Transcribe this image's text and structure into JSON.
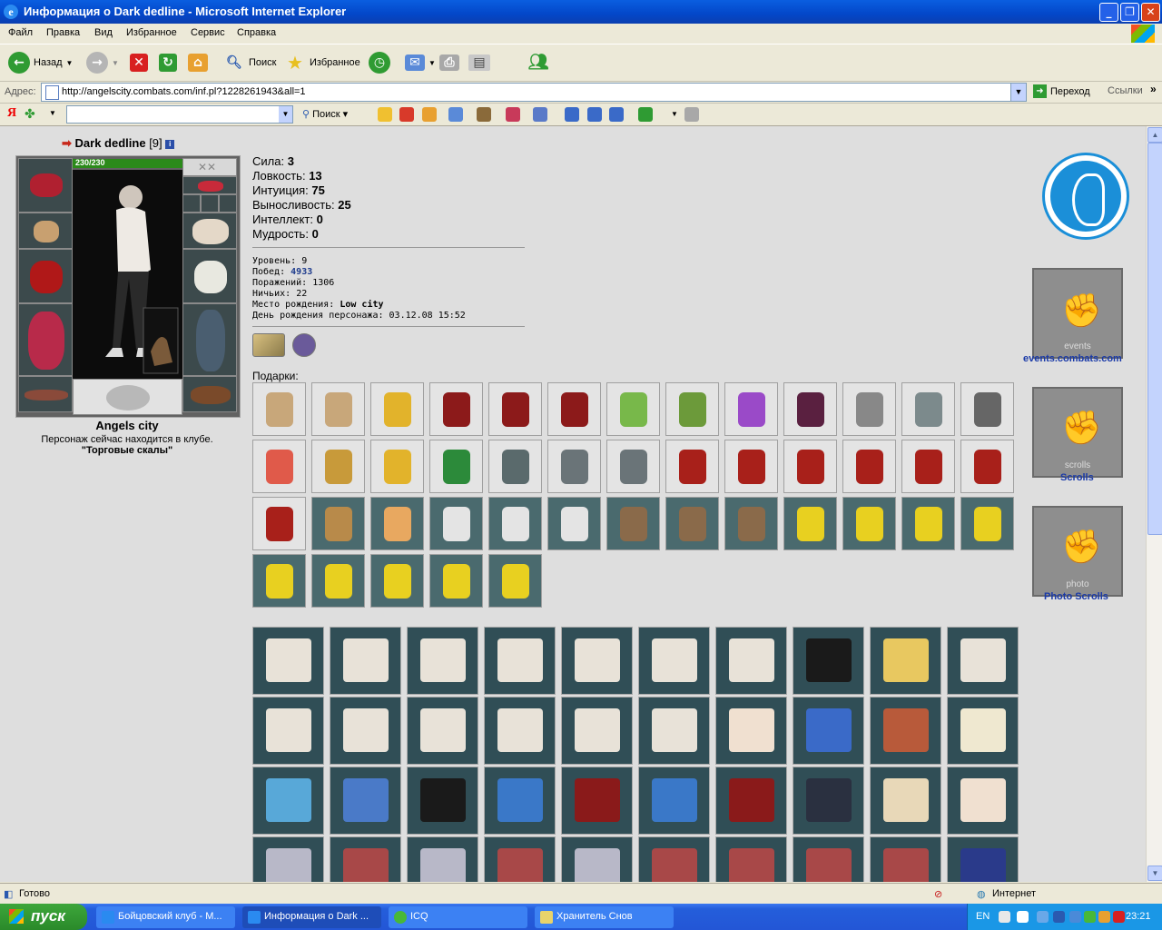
{
  "window": {
    "title": "Информация о Dark dedline - Microsoft Internet Explorer",
    "icon": "ie-icon"
  },
  "menu": [
    "Файл",
    "Правка",
    "Вид",
    "Избранное",
    "Сервис",
    "Справка"
  ],
  "toolbar": {
    "back_label": "Назад",
    "search_label": "Поиск",
    "favorites_label": "Избранное"
  },
  "address": {
    "label": "Адрес:",
    "url": "http://angelscity.combats.com/inf.pl?1228261943&all=1",
    "go_label": "Переход",
    "links_label": "Ссылки"
  },
  "yandex": {
    "logo": "Я",
    "search_label": "Поиск"
  },
  "character": {
    "name": "Dark dedline",
    "level_tag": "[9]",
    "hp": "230/230",
    "hp_fraction": 1.0,
    "city": "Angels city",
    "location_text": "Персонаж сейчас находится в клубе.",
    "club": "\"Торговые скалы\""
  },
  "stats": [
    {
      "label": "Сила:",
      "value": "3"
    },
    {
      "label": "Ловкость:",
      "value": "13"
    },
    {
      "label": "Интуиция:",
      "value": "75"
    },
    {
      "label": "Выносливость:",
      "value": "25"
    },
    {
      "label": "Интеллект:",
      "value": "0"
    },
    {
      "label": "Мудрость:",
      "value": "0"
    }
  ],
  "info": [
    {
      "label": "Уровень:",
      "value": "9"
    },
    {
      "label": "Побед:",
      "value": "4933"
    },
    {
      "label": "Поражений:",
      "value": "1306"
    },
    {
      "label": "Ничьих:",
      "value": "22"
    },
    {
      "label": "Место рождения:",
      "value": "Low city"
    },
    {
      "label": "День рождения персонажа:",
      "value": "03.12.08 15:52"
    }
  ],
  "gifts_label": "Подарки:",
  "gifts": [
    {
      "icon": "scroll-gift",
      "color": "#c8a77a",
      "bg": "#e4e4e4"
    },
    {
      "icon": "scroll-gift",
      "color": "#c8a77a",
      "bg": "#e4e4e4"
    },
    {
      "icon": "bell-gift",
      "color": "#e2b32b",
      "bg": "#e4e4e4"
    },
    {
      "icon": "calendar-2006-gift",
      "color": "#8c1a1a",
      "bg": "#e4e4e4"
    },
    {
      "icon": "calendar-2006-gift",
      "color": "#8c1a1a",
      "bg": "#e4e4e4"
    },
    {
      "icon": "calendar-2006-gift",
      "color": "#8c1a1a",
      "bg": "#e4e4e4"
    },
    {
      "icon": "bottle-gift",
      "color": "#78b84a",
      "bg": "#e4e4e4"
    },
    {
      "icon": "goblin-gift",
      "color": "#6c9a3a",
      "bg": "#e4e4e4"
    },
    {
      "icon": "potion-gift",
      "color": "#9a4ac8",
      "bg": "#e4e4e4"
    },
    {
      "icon": "book-gift",
      "color": "#5a2040",
      "bg": "#e4e4e4"
    },
    {
      "icon": "keychain-gift",
      "color": "#888888",
      "bg": "#e4e4e4"
    },
    {
      "icon": "stein-gift",
      "color": "#7c8a8c",
      "bg": "#e4e4e4"
    },
    {
      "icon": "swords-gift",
      "color": "#666666",
      "bg": "#e4e4e4"
    },
    {
      "icon": "crystal-ball-gift",
      "color": "#e05a4a",
      "bg": "#e4e4e4"
    },
    {
      "icon": "chess-gift",
      "color": "#c89a3a",
      "bg": "#e4e4e4"
    },
    {
      "icon": "gold-bar-gift",
      "color": "#e2b32b",
      "bg": "#e4e4e4"
    },
    {
      "icon": "green-cloak-gift",
      "color": "#2c8a3a",
      "bg": "#e4e4e4"
    },
    {
      "icon": "star-medal-gift",
      "color": "#5a6a6c",
      "bg": "#e4e4e4"
    },
    {
      "icon": "grey-cloak-gift",
      "color": "#6a7478",
      "bg": "#e4e4e4"
    },
    {
      "icon": "grey-cloak-gift",
      "color": "#6a7478",
      "bg": "#e4e4e4"
    },
    {
      "icon": "red-cloak-gift",
      "color": "#a8201a",
      "bg": "#e4e4e4"
    },
    {
      "icon": "red-cloak-gift",
      "color": "#a8201a",
      "bg": "#e4e4e4"
    },
    {
      "icon": "red-cloak-gift",
      "color": "#a8201a",
      "bg": "#e4e4e4"
    },
    {
      "icon": "red-cloak-gift",
      "color": "#a8201a",
      "bg": "#e4e4e4"
    },
    {
      "icon": "red-cloak-gift",
      "color": "#a8201a",
      "bg": "#e4e4e4"
    },
    {
      "icon": "red-cloak-gift",
      "color": "#a8201a",
      "bg": "#e4e4e4"
    },
    {
      "icon": "red-cloak-gift",
      "color": "#a8201a",
      "bg": "#e4e4e4"
    },
    {
      "icon": "acorn-gift",
      "color": "#b88a4a",
      "bg": "#4a6a6e"
    },
    {
      "icon": "tiger-gift",
      "color": "#e8a860",
      "bg": "#4a6a6e"
    },
    {
      "icon": "penguin-house-gift",
      "color": "#e4e4e4",
      "bg": "#4a6a6e"
    },
    {
      "icon": "penguin-house-gift",
      "color": "#e4e4e4",
      "bg": "#4a6a6e"
    },
    {
      "icon": "penguin-house-gift",
      "color": "#e4e4e4",
      "bg": "#4a6a6e"
    },
    {
      "icon": "hedgehog-gift",
      "color": "#8a6a4a",
      "bg": "#4a6a6e"
    },
    {
      "icon": "hedgehog-gift",
      "color": "#8a6a4a",
      "bg": "#4a6a6e"
    },
    {
      "icon": "hedgehog-gift",
      "color": "#8a6a4a",
      "bg": "#4a6a6e"
    },
    {
      "icon": "smiley-hat-gift",
      "color": "#e8d020",
      "bg": "#4a6a6e"
    },
    {
      "icon": "smiley-hat-gift",
      "color": "#e8d020",
      "bg": "#4a6a6e"
    },
    {
      "icon": "smiley-hat-gift",
      "color": "#e8d020",
      "bg": "#4a6a6e"
    },
    {
      "icon": "smiley-hat-gift",
      "color": "#e8d020",
      "bg": "#4a6a6e"
    },
    {
      "icon": "smiley-hat-gift",
      "color": "#e8d020",
      "bg": "#4a6a6e"
    },
    {
      "icon": "smiley-hat-gift",
      "color": "#e8d020",
      "bg": "#4a6a6e"
    },
    {
      "icon": "smiley-hat-gift",
      "color": "#e8d020",
      "bg": "#4a6a6e"
    },
    {
      "icon": "smiley-hat-gift",
      "color": "#e8d020",
      "bg": "#4a6a6e"
    },
    {
      "icon": "smiley-hat-gift",
      "color": "#e8d020",
      "bg": "#4a6a6e"
    }
  ],
  "cards": [
    {
      "icon": "gift-box",
      "color": "#e8e2d8"
    },
    {
      "icon": "gift-box",
      "color": "#e8e2d8"
    },
    {
      "icon": "gift-box",
      "color": "#e8e2d8"
    },
    {
      "icon": "gift-box",
      "color": "#e8e2d8"
    },
    {
      "icon": "gift-box",
      "color": "#e8e2d8"
    },
    {
      "icon": "gift-box",
      "color": "#e8e2d8"
    },
    {
      "icon": "gift-box",
      "color": "#e8e2d8"
    },
    {
      "icon": "gift-bag",
      "color": "#1a1a1a"
    },
    {
      "icon": "flower-card",
      "color": "#e8c860"
    },
    {
      "icon": "gift-box",
      "color": "#e8e2d8"
    },
    {
      "icon": "gift-box",
      "color": "#e8e2d8"
    },
    {
      "icon": "gift-box",
      "color": "#e8e2d8"
    },
    {
      "icon": "gift-box",
      "color": "#e8e2d8"
    },
    {
      "icon": "gift-box",
      "color": "#e8e2d8"
    },
    {
      "icon": "gift-box",
      "color": "#e8e2d8"
    },
    {
      "icon": "gift-box",
      "color": "#e8e2d8"
    },
    {
      "icon": "invitation-card",
      "color": "#f0e0d0"
    },
    {
      "icon": "candle-jar",
      "color": "#3a6ac8"
    },
    {
      "icon": "portrait-card",
      "color": "#b85a3a"
    },
    {
      "icon": "rings-card",
      "color": "#efe8d0"
    },
    {
      "icon": "new-year-card",
      "color": "#58a8d8"
    },
    {
      "icon": "2009-card",
      "color": "#4a7ac8"
    },
    {
      "icon": "fireworks-card",
      "color": "#1a1a1a"
    },
    {
      "icon": "may9-card",
      "color": "#3a78c8"
    },
    {
      "icon": "may9-star-card",
      "color": "#8a1a1a"
    },
    {
      "icon": "may9-card",
      "color": "#3a78c8"
    },
    {
      "icon": "may9-star-card",
      "color": "#8a1a1a"
    },
    {
      "icon": "birthday-card",
      "color": "#2a3040"
    },
    {
      "icon": "wine-card",
      "color": "#e8d8b8"
    },
    {
      "icon": "invitation-card",
      "color": "#f0e0d0"
    },
    {
      "icon": "silver-mask",
      "color": "#b8b8c8"
    },
    {
      "icon": "red-mask",
      "color": "#a84848"
    },
    {
      "icon": "silver-mask",
      "color": "#b8b8c8"
    },
    {
      "icon": "red-mask",
      "color": "#a84848"
    },
    {
      "icon": "silver-mask",
      "color": "#b8b8c8"
    },
    {
      "icon": "red-mask",
      "color": "#a84848"
    },
    {
      "icon": "red-mask",
      "color": "#a84848"
    },
    {
      "icon": "red-mask",
      "color": "#a84848"
    },
    {
      "icon": "red-mask",
      "color": "#a84848"
    },
    {
      "icon": "2010-card",
      "color": "#2a3a8a"
    }
  ],
  "sidebar": {
    "events_label": "events.combats.com",
    "events_tag": "events",
    "scrolls_label": "Scrolls",
    "scrolls_tag": "scrolls",
    "photo_label": "Photo Scrolls",
    "photo_tag": "photo"
  },
  "statusbar": {
    "text": "Готово",
    "zone": "Интернет"
  },
  "taskbar": {
    "start": "пуск",
    "tasks": [
      "Бойцовский клуб - М...",
      "Информация о Dark ...",
      "ICQ",
      "Хранитель Снов"
    ],
    "lang": "EN",
    "time": "23:21"
  }
}
